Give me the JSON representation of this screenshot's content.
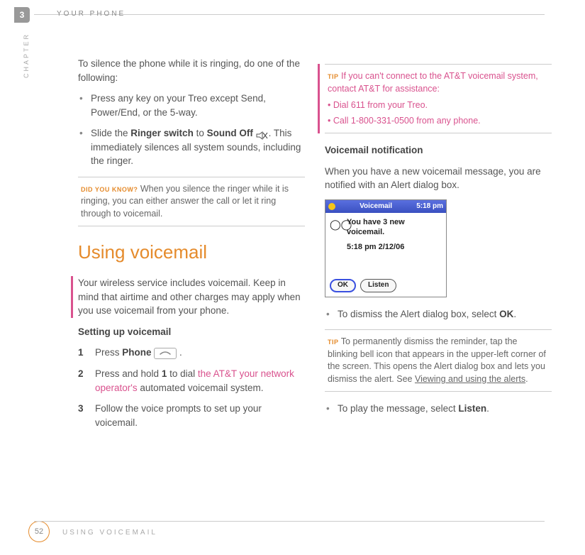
{
  "header": {
    "chapter_num": "3",
    "chapter_label": "CHAPTER",
    "title": "YOUR PHONE"
  },
  "left": {
    "intro": "To silence the phone while it is ringing, do one of the following:",
    "b1": "Press any key on your Treo except Send, Power/End, or the 5-way.",
    "b2_a": "Slide the ",
    "b2_b": "Ringer switch",
    "b2_c": " to ",
    "b2_d": "Sound Off",
    "b2_e": ". This immediately silences all system sounds, including the ringer.",
    "dyk_label": "DID YOU KNOW?",
    "dyk_text": " When you silence the ringer while it is ringing, you can either answer the call or let it ring through to voicemail.",
    "h1": "Using voicemail",
    "p2": "Your wireless service includes voicemail. Keep in mind that airtime and other charges may apply when you use voicemail from your phone.",
    "sub1": "Setting up voicemail",
    "s1_a": "Press ",
    "s1_b": "Phone",
    "s1_c": " .",
    "s2_a": "Press and hold ",
    "s2_b": "1",
    "s2_c": " to dial ",
    "s2_d": "the AT&T",
    "s2_e": " your network operator's",
    "s2_f": " automated voicemail system.",
    "s3": "Follow the voice prompts to set up your voicemail.",
    "n1": "1",
    "n2": "2",
    "n3": "3"
  },
  "right": {
    "tip1_label": "TIP",
    "tip1_l1": " If you can't connect to the AT&T voicemail system, contact AT&T for assistance:",
    "tip1_b1": "Dial 611 from your Treo.",
    "tip1_b2": "Call 1-800-331-0500 from any phone.",
    "sub2": "Voicemail notification",
    "p3": "When you have a new voicemail message, you are notified with an Alert dialog box.",
    "shot": {
      "title": "Voicemail",
      "time": "5:18 pm",
      "line1": "You have 3 new",
      "line2": "voicemail.",
      "line3": "5:18 pm 2/12/06",
      "ok": "OK",
      "listen": "Listen",
      "tape": "◯◯"
    },
    "b3_a": "To dismiss the Alert dialog box, select ",
    "b3_b": "OK",
    "b3_c": ".",
    "tip2_label": "TIP",
    "tip2_a": " To permanently dismiss the reminder, tap the blinking bell icon that appears in the upper-left corner of the screen. This opens the Alert dialog box and lets you dismiss the alert. See ",
    "tip2_link": "Viewing and using the alerts",
    "tip2_b": ".",
    "b4_a": "To play the message, select ",
    "b4_b": "Listen",
    "b4_c": "."
  },
  "footer": {
    "page": "52",
    "label": "USING VOICEMAIL"
  }
}
